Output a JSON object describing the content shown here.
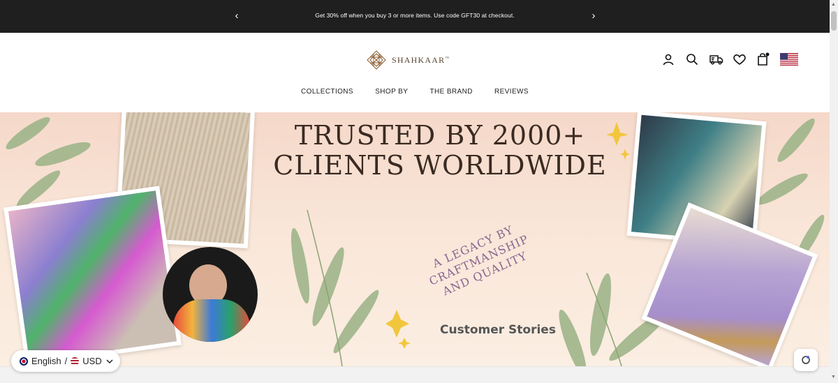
{
  "announcement": {
    "message": "Get 30% off when you buy 3 or more items. Use code GFT30 at checkout.",
    "prev_icon": "chevron-left-icon",
    "next_icon": "chevron-right-icon"
  },
  "header": {
    "logo_text": "SHAHKAAR",
    "logo_tm": "™",
    "icons": [
      "account-icon",
      "search-icon",
      "truck-icon",
      "heart-icon",
      "cart-icon",
      "us-flag-icon"
    ]
  },
  "nav": {
    "items": [
      {
        "label": "COLLECTIONS"
      },
      {
        "label": "SHOP BY"
      },
      {
        "label": "THE BRAND"
      },
      {
        "label": "REVIEWS"
      }
    ]
  },
  "hero": {
    "headline_line1": "TRUSTED  BY 2000+",
    "headline_line2": "CLIENTS WORLDWIDE",
    "tagline_line1": "A LEGACY BY CRAFTMANSHIP",
    "tagline_line2": "AND QUALITY",
    "cta": "Customer Stories",
    "colors": {
      "headline": "#3a2a22",
      "tagline": "#8a6590",
      "leaf": "#9fb58a",
      "sparkle": "#f2c63c"
    }
  },
  "locale": {
    "language": "English",
    "separator": "/",
    "currency": "USD"
  }
}
